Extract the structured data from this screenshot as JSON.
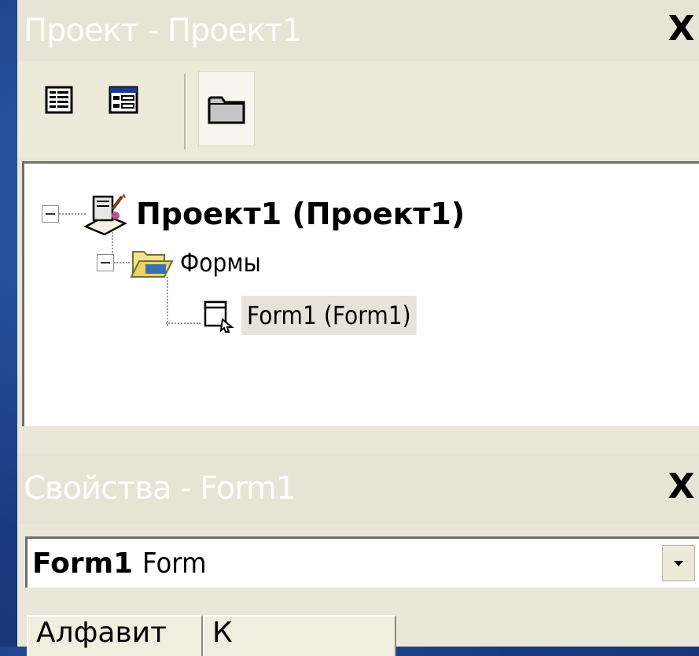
{
  "project_window": {
    "title": "Проект - Проект1",
    "close_label": "X",
    "toolbar": {
      "buttons": [
        {
          "icon": "view-code-icon"
        },
        {
          "icon": "view-object-icon"
        },
        {
          "icon": "toggle-folders-icon"
        }
      ]
    },
    "tree": {
      "root_label": "Проект1 (Проект1)",
      "folder_label": "Формы",
      "form_label": "Form1 (Form1)"
    }
  },
  "properties_window": {
    "title": "Свойства - Form1",
    "close_label": "X",
    "object_selector": {
      "name": "Form1",
      "type": "Form"
    },
    "tabs": [
      {
        "label": "Алфавит"
      },
      {
        "label": "К"
      }
    ]
  },
  "colors": {
    "desktop": "#1c3f86",
    "panel": "#e9e7d8",
    "titlebar_text": "#ffffff"
  }
}
